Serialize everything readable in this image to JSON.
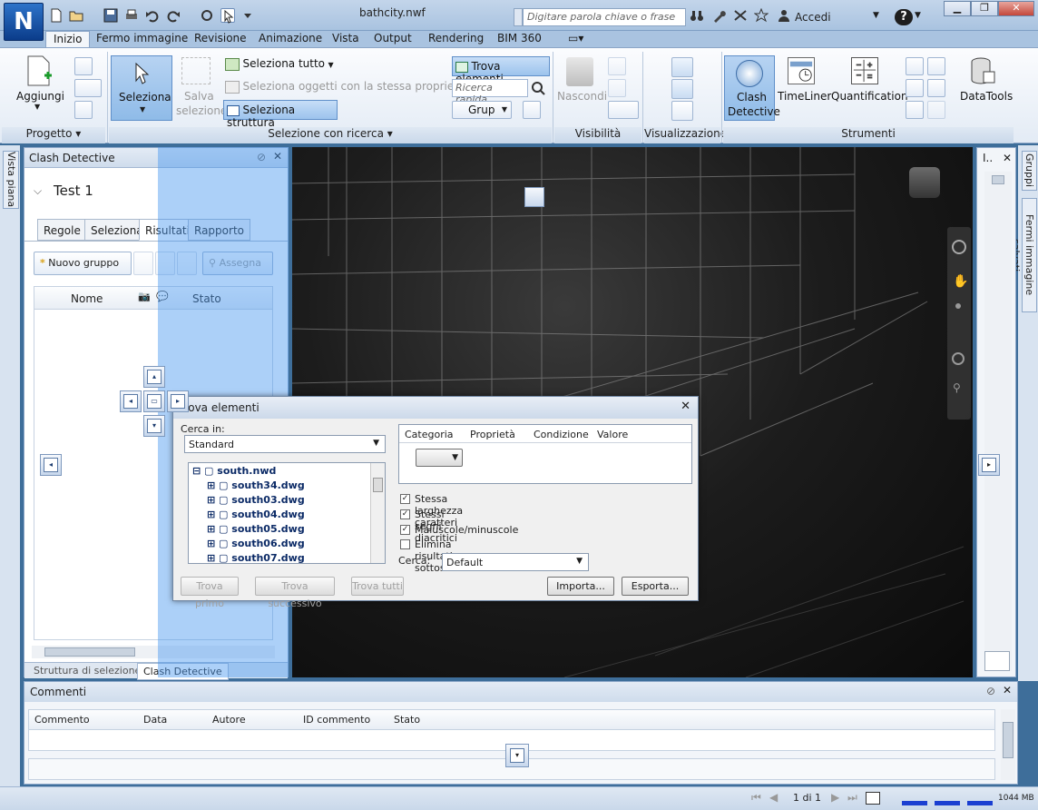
{
  "window": {
    "app_logo": "N",
    "doc_title": "bathcity.nwf",
    "search_placeholder": "Digitare parola chiave o frase",
    "sign_in": "Accedi",
    "help": "?"
  },
  "ribbon": {
    "tabs": [
      "Inizio",
      "Fermo immagine",
      "Revisione",
      "Animazione",
      "Vista",
      "Output",
      "Rendering",
      "BIM 360"
    ],
    "active_tab": "Inizio",
    "groups": {
      "progetto": "Progetto",
      "selezione": "Selezione con ricerca",
      "visibilita": "Visibilità",
      "visualizzazione": "Visualizzazione",
      "strumenti": "Strumenti"
    },
    "buttons": {
      "aggiungi": "Aggiungi",
      "seleziona": "Seleziona",
      "salva_sel_1": "Salva",
      "salva_sel_2": "selezione",
      "seleziona_tutto": "Seleziona tutto",
      "seleziona_stessa": "Seleziona oggetti con la stessa proprietà",
      "seleziona_struttura": "Seleziona struttura",
      "trova_elementi": "Trova elementi",
      "ricerca_rapida": "Ricerca rapida",
      "grup": "Grup",
      "nascondi": "Nascondi",
      "clash_1": "Clash",
      "clash_2": "Detective",
      "timeliner": "TimeLiner",
      "quantification": "Quantification",
      "datatools": "DataTools"
    }
  },
  "side_tabs": {
    "left": "Vista piana",
    "right_1": "Gruppi",
    "right_2": "Fermi immagine salvati"
  },
  "clash_panel": {
    "title": "Clash Detective",
    "test_name": "Test 1",
    "tabs": [
      "Regole",
      "Seleziona",
      "Risultati",
      "Rapporto"
    ],
    "active_tab": "Risultati",
    "new_group": "Nuovo gruppo",
    "assign": "Assegna",
    "col_name": "Nome",
    "col_status": "Stato",
    "bottom_tabs": [
      "Struttura di selezione",
      "Clash Detective"
    ]
  },
  "props_panel": {
    "title": "I.."
  },
  "comments": {
    "title": "Commenti",
    "columns": [
      "Commento",
      "Data",
      "Autore",
      "ID commento",
      "Stato"
    ]
  },
  "status": {
    "page": "1 di 1",
    "memory": "1044 MB"
  },
  "find_dialog": {
    "title": "Trova elementi",
    "search_in_label": "Cerca in:",
    "search_in_value": "Standard",
    "tree": [
      {
        "name": "south.nwd",
        "root": true
      },
      {
        "name": "south34.dwg"
      },
      {
        "name": "south03.dwg"
      },
      {
        "name": "south04.dwg"
      },
      {
        "name": "south05.dwg"
      },
      {
        "name": "south06.dwg"
      },
      {
        "name": "south07.dwg"
      }
    ],
    "grid_columns": [
      "Categoria",
      "Proprietà",
      "Condizione",
      "Valore"
    ],
    "checks": [
      {
        "label": "Stessa larghezza caratteri",
        "checked": true
      },
      {
        "label": "Stessi segni diacritici",
        "checked": true
      },
      {
        "label": "Maiuscole/minuscole",
        "checked": true
      },
      {
        "label": "Elimina risultati sottostanti",
        "checked": false
      }
    ],
    "search_label": "Cerca:",
    "search_value": "Default",
    "buttons": {
      "find_first": "Trova primo",
      "find_next": "Trova successivo",
      "find_all": "Trova tutti",
      "import": "Importa...",
      "export": "Esporta..."
    }
  }
}
